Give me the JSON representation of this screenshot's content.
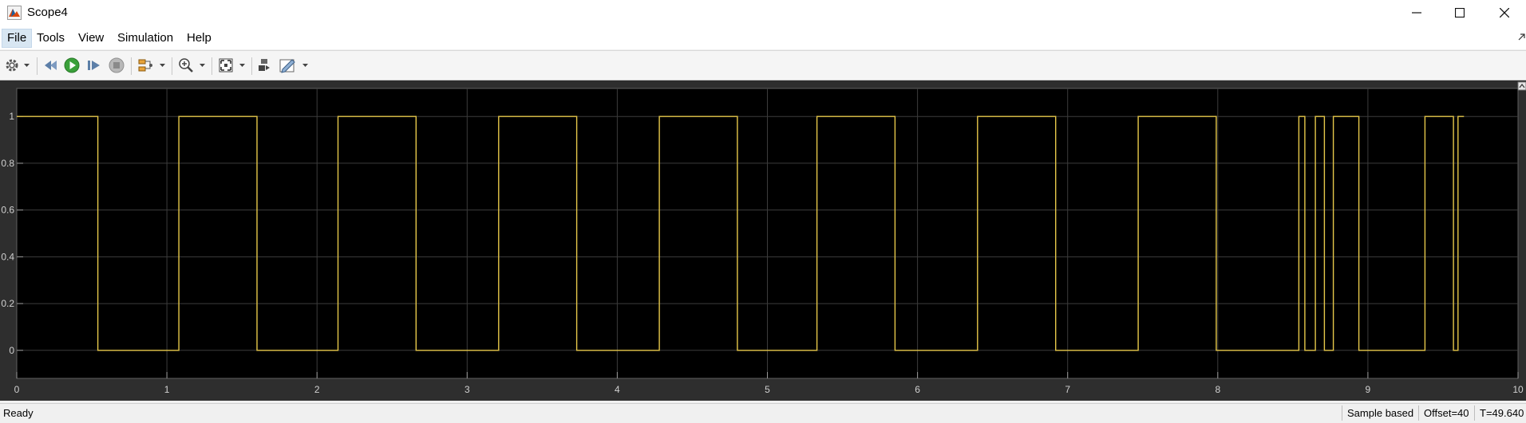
{
  "window": {
    "title": "Scope4",
    "icon": "matlab-scope-icon",
    "controls": [
      "minimize-icon",
      "maximize-icon",
      "close-icon"
    ]
  },
  "menu": {
    "items": [
      {
        "label": "File",
        "active": true
      },
      {
        "label": "Tools"
      },
      {
        "label": "View"
      },
      {
        "label": "Simulation"
      },
      {
        "label": "Help"
      }
    ]
  },
  "toolbar": {
    "buttons": [
      "settings-gear-icon",
      "dropdown-arrow",
      "step-back-icon",
      "run-icon",
      "step-forward-icon",
      "stop-icon",
      "signal-tools-icon",
      "dropdown-arrow",
      "zoom-in-icon",
      "dropdown-arrow",
      "fit-axes-icon",
      "dropdown-arrow",
      "highlight-simulink-block-icon",
      "edit-style-icon",
      "dropdown-arrow"
    ]
  },
  "chart_data": {
    "type": "line",
    "style": "step",
    "background": "#000000",
    "line_color": "#e6c84a",
    "grid": true,
    "xlim": [
      0,
      10
    ],
    "ylim": [
      -0.12,
      1.12
    ],
    "xticks": [
      0,
      1,
      2,
      3,
      4,
      5,
      6,
      7,
      8,
      9,
      10
    ],
    "yticks": [
      0,
      0.2,
      0.4,
      0.6,
      0.8,
      1
    ],
    "xtick_labels": [
      "0",
      "1",
      "2",
      "3",
      "4",
      "5",
      "6",
      "7",
      "8",
      "9",
      "10"
    ],
    "ytick_labels": [
      "0",
      "0.2",
      "0.4",
      "0.6",
      "0.8",
      "1"
    ],
    "series": [
      {
        "x": [
          0,
          0.54,
          1.08,
          1.6,
          2.14,
          2.66,
          3.21,
          3.73,
          4.28,
          4.8,
          5.33,
          5.85,
          6.4,
          6.92,
          7.47,
          7.99,
          8.54,
          8.58,
          8.65,
          8.71,
          8.77,
          8.94,
          9.38,
          9.57,
          9.6,
          9.64
        ],
        "y": [
          1,
          0,
          1,
          0,
          1,
          0,
          1,
          0,
          1,
          0,
          1,
          0,
          1,
          0,
          1,
          0,
          1,
          0,
          1,
          0,
          1,
          0,
          1,
          0,
          1,
          1
        ]
      }
    ]
  },
  "status": {
    "left": "Ready",
    "mode": "Sample based",
    "offset": "Offset=40",
    "time": "T=49.640"
  }
}
